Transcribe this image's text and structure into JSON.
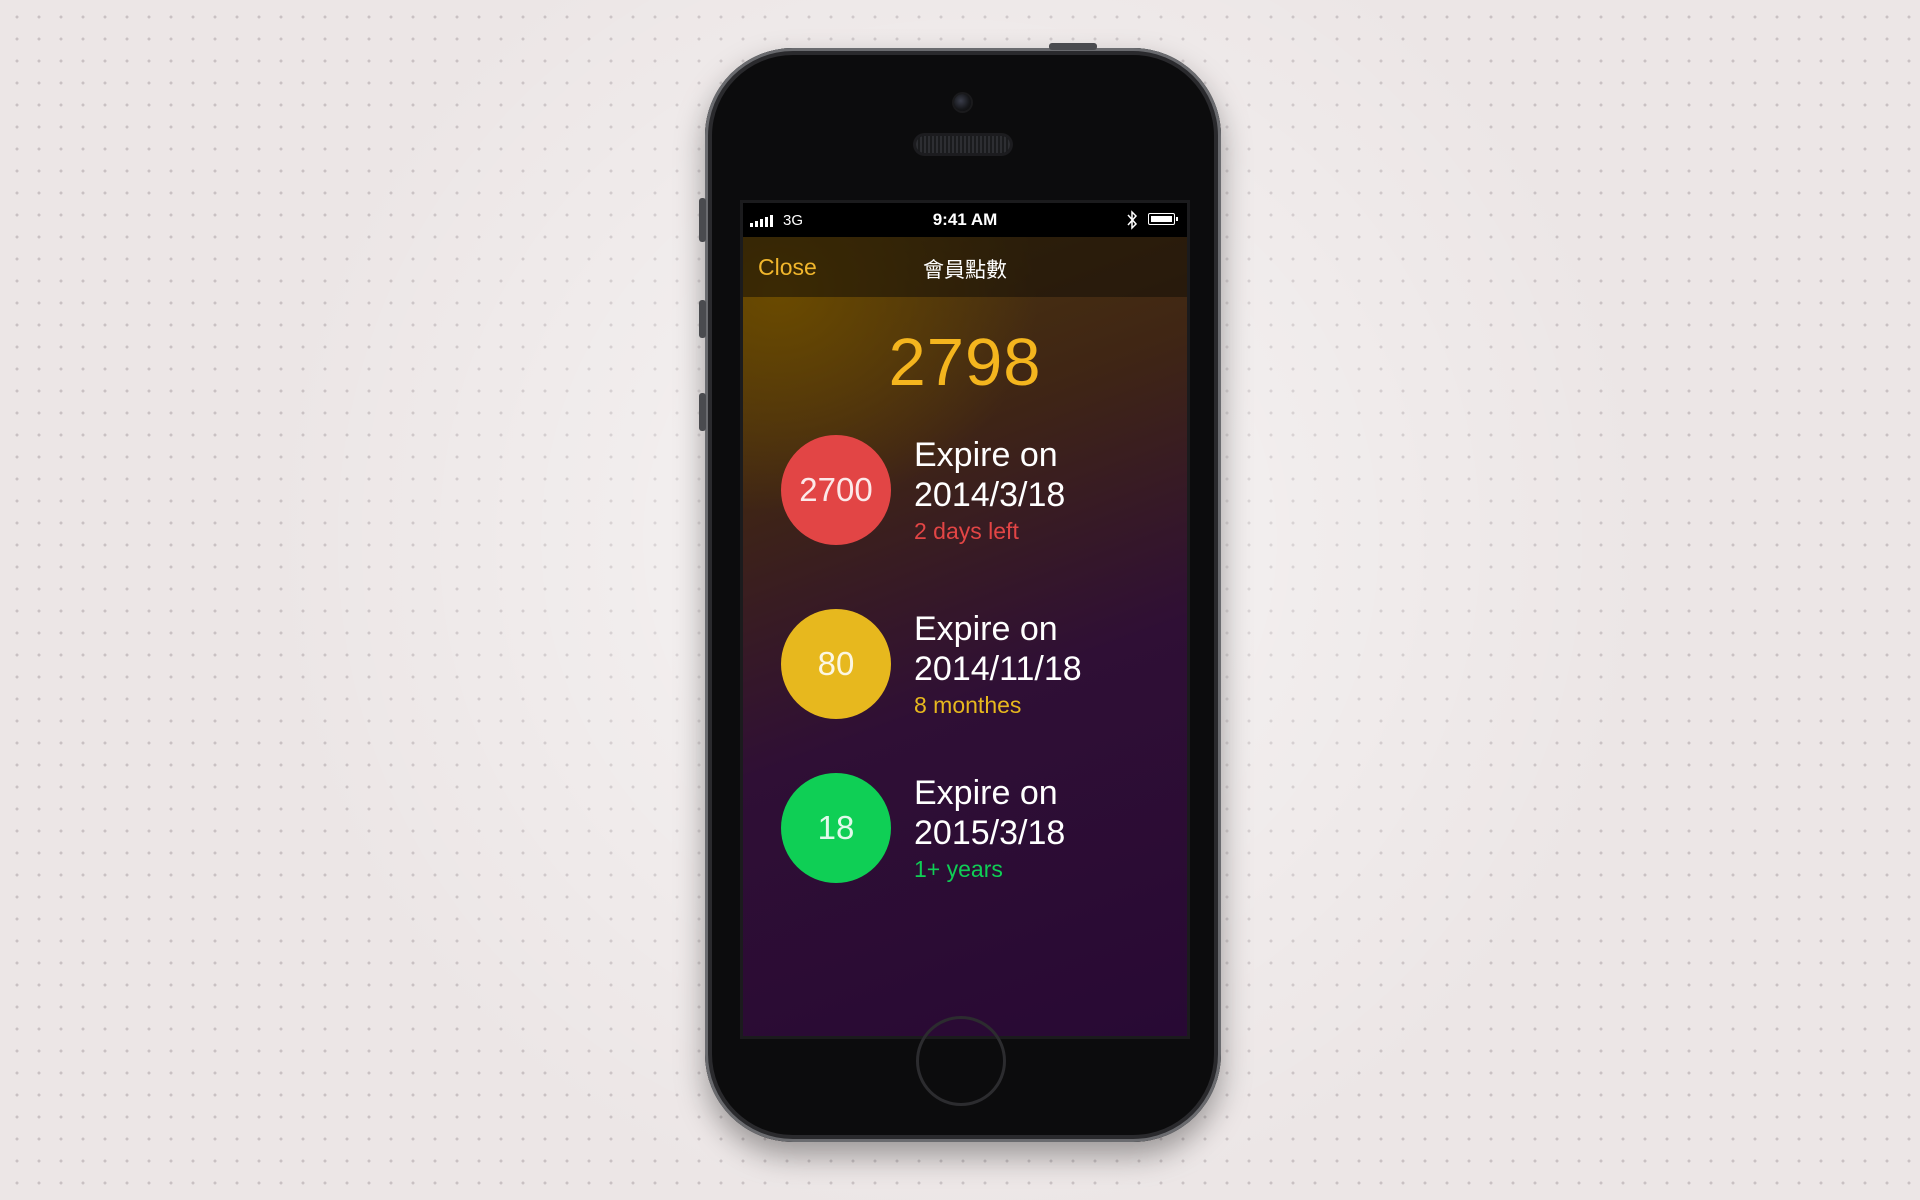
{
  "status_bar": {
    "carrier": "3G",
    "time": "9:41 AM",
    "icons": [
      "signal-bars-icon",
      "bluetooth-icon",
      "battery-icon"
    ]
  },
  "nav": {
    "close_label": "Close",
    "title": "會員點數"
  },
  "total_points": "2798",
  "expiry_items": [
    {
      "points": "2700",
      "label": "Expire on",
      "date": "2014/3/18",
      "remaining": "2 days left",
      "color": "#e24545"
    },
    {
      "points": "80",
      "label": "Expire on",
      "date": "2014/11/18",
      "remaining": "8 monthes",
      "color": "#e7b81e"
    },
    {
      "points": "18",
      "label": "Expire on",
      "date": "2015/3/18",
      "remaining": "1+ years",
      "color": "#0fcf55"
    }
  ],
  "colors": {
    "accent": "#f4b51e",
    "background_top": "#5a3f05",
    "background_bottom": "#280934"
  }
}
